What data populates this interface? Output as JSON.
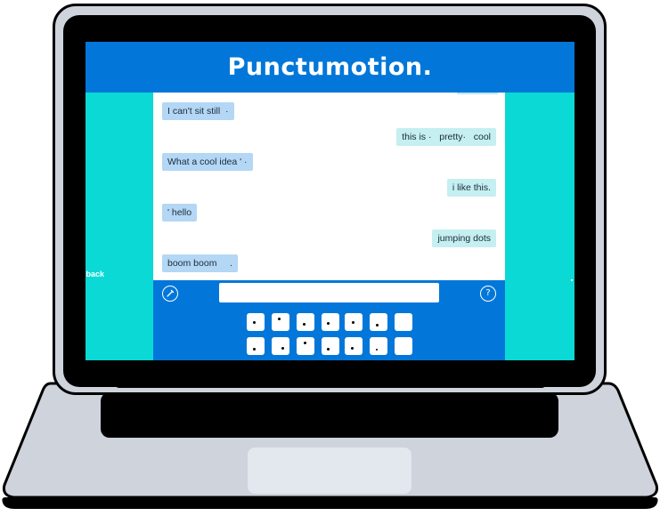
{
  "app": {
    "title": "Punctumotion."
  },
  "side_label": "lback",
  "messages": [
    {
      "text": "I can't sit still  ·",
      "side": "left"
    },
    {
      "text": "this is ·   pretty·   cool",
      "side": "right"
    },
    {
      "text": "What a cool idea ' ·",
      "side": "left"
    },
    {
      "text": "i like this.",
      "side": "right"
    },
    {
      "text": "' hello",
      "side": "left"
    },
    {
      "text": "jumping dots",
      "side": "right"
    },
    {
      "text": "boom boom     .",
      "side": "left"
    }
  ],
  "input": {
    "value": "",
    "placeholder": ""
  },
  "buttons": {
    "pen_icon": "pencil-icon",
    "help_label": "?"
  },
  "colors": {
    "header": "#0277d9",
    "side_panels": "#0ad9d5",
    "bubble_left": "#b3d7f5",
    "bubble_right": "#c5eff0",
    "frame": "#ced3dc"
  }
}
